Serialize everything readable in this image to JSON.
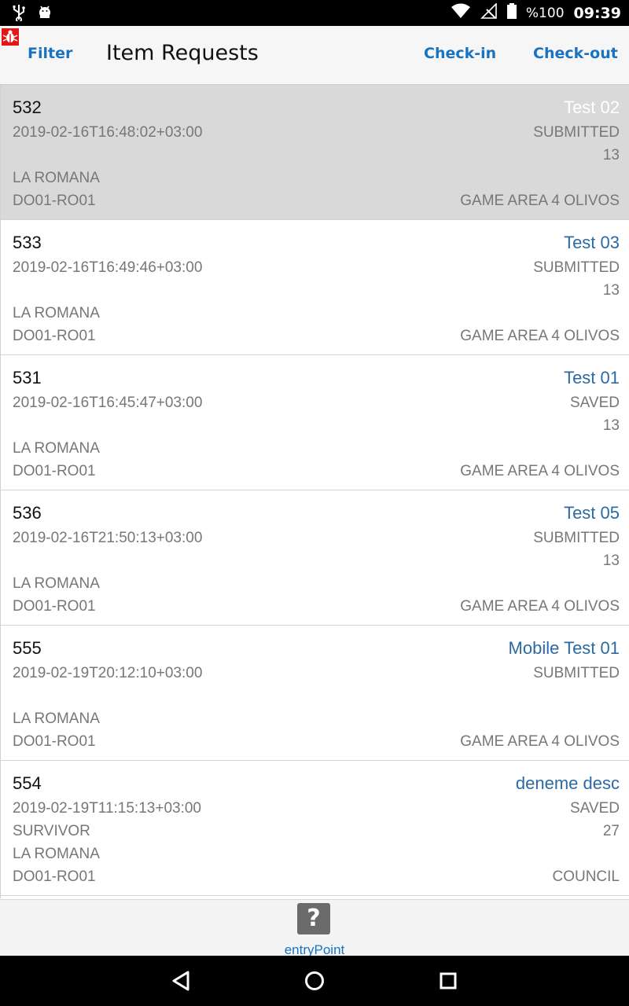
{
  "status_bar": {
    "battery_text": "%100",
    "time": "09:39",
    "icons": [
      "usb-icon",
      "android-debug-icon",
      "wifi-icon",
      "no-signal-icon",
      "battery-icon"
    ]
  },
  "header": {
    "filter_label": "Filter",
    "title": "Item Requests",
    "checkin_label": "Check-in",
    "checkout_label": "Check-out",
    "accent_color": "#1a73c0"
  },
  "requests": [
    {
      "id": "532",
      "description": "Test 02",
      "date": "2019-02-16T16:48:02+03:00",
      "status": "SUBMITTED",
      "extra": "",
      "count": "13",
      "city": "LA ROMANA",
      "code": "DO01-RO01",
      "area": "GAME AREA 4 OLIVOS",
      "selected": true
    },
    {
      "id": "533",
      "description": "Test 03",
      "date": "2019-02-16T16:49:46+03:00",
      "status": "SUBMITTED",
      "extra": "",
      "count": "13",
      "city": "LA ROMANA",
      "code": "DO01-RO01",
      "area": "GAME AREA 4 OLIVOS",
      "selected": false
    },
    {
      "id": "531",
      "description": "Test 01",
      "date": "2019-02-16T16:45:47+03:00",
      "status": "SAVED",
      "extra": "",
      "count": "13",
      "city": "LA ROMANA",
      "code": "DO01-RO01",
      "area": "GAME AREA 4 OLIVOS",
      "selected": false
    },
    {
      "id": "536",
      "description": "Test 05",
      "date": "2019-02-16T21:50:13+03:00",
      "status": "SUBMITTED",
      "extra": "",
      "count": "13",
      "city": "LA ROMANA",
      "code": "DO01-RO01",
      "area": "GAME AREA 4 OLIVOS",
      "selected": false
    },
    {
      "id": "555",
      "description": "Mobile Test 01",
      "date": "2019-02-19T20:12:10+03:00",
      "status": "SUBMITTED",
      "extra": "",
      "count": "",
      "city": "LA ROMANA",
      "code": "DO01-RO01",
      "area": "GAME AREA 4 OLIVOS",
      "selected": false
    },
    {
      "id": "554",
      "description": "deneme desc",
      "date": "2019-02-19T11:15:13+03:00",
      "status": "SAVED",
      "extra": "SURVIVOR",
      "count": "27",
      "city": "LA ROMANA",
      "code": "DO01-RO01",
      "area": "COUNCIL",
      "selected": false
    }
  ],
  "bottom_tab": {
    "label": "entryPoint",
    "icon": "question-icon",
    "icon_glyph": "?"
  },
  "nav_bar": {
    "buttons": [
      "back-icon",
      "home-icon",
      "recents-icon"
    ]
  }
}
